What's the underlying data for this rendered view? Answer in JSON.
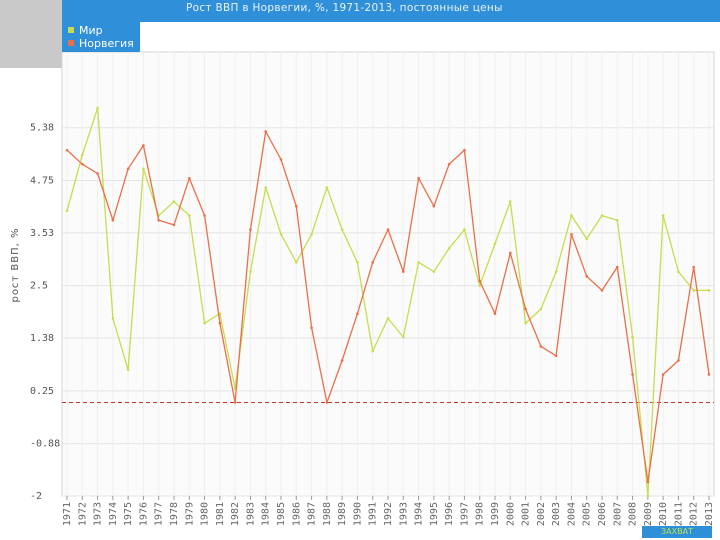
{
  "header": {
    "title": "Рост ВВП в Норвегии, %, 1971-2013, постоянные цены"
  },
  "colors": {
    "world": "#c8dc50",
    "norway": "#e8704a",
    "accent": "#2f8fd8",
    "reference": "#c0392b"
  },
  "chart_data": {
    "type": "line",
    "ylabel": "рост ВВП, %",
    "ylim": [
      -2,
      7.5
    ],
    "yticks": [
      -2,
      -0.88,
      0.25,
      1.38,
      2.5,
      3.63,
      4.75,
      5.88
    ],
    "ytick_labels": [
      "-2",
      "-0.88",
      "0.25",
      "1.38",
      "2.5",
      "3.53",
      "4.75",
      "5.38"
    ],
    "reference_line": 0.0,
    "legend": "top-left",
    "grid": true,
    "categories": [
      "1971",
      "1972",
      "1973",
      "1974",
      "1975",
      "1976",
      "1977",
      "1978",
      "1979",
      "1980",
      "1981",
      "1982",
      "1983",
      "1984",
      "1985",
      "1986",
      "1987",
      "1988",
      "1989",
      "1990",
      "1991",
      "1992",
      "1993",
      "1994",
      "1995",
      "1996",
      "1997",
      "1998",
      "1999",
      "2000",
      "2001",
      "2002",
      "2003",
      "2004",
      "2005",
      "2006",
      "2007",
      "2008",
      "2009",
      "2010",
      "2011",
      "2012",
      "2013"
    ],
    "series": [
      {
        "name": "Мир",
        "values": [
          4.1,
          5.3,
          6.3,
          1.8,
          0.7,
          5.0,
          4.0,
          4.3,
          4.0,
          1.7,
          1.9,
          0.3,
          2.8,
          4.6,
          3.6,
          3.0,
          3.6,
          4.6,
          3.7,
          3.0,
          1.1,
          1.8,
          1.4,
          3.0,
          2.8,
          3.3,
          3.7,
          2.5,
          3.4,
          4.3,
          1.7,
          2.0,
          2.8,
          4.0,
          3.5,
          4.0,
          3.9,
          1.4,
          -2.0,
          4.0,
          2.8,
          2.4,
          2.4
        ]
      },
      {
        "name": "Норвегия",
        "values": [
          5.4,
          5.1,
          4.9,
          3.9,
          5.0,
          5.5,
          3.9,
          3.8,
          4.8,
          4.0,
          1.7,
          0.0,
          3.7,
          5.8,
          5.2,
          4.2,
          1.6,
          0.0,
          0.9,
          1.9,
          3.0,
          3.7,
          2.8,
          4.8,
          4.2,
          5.1,
          5.4,
          2.6,
          1.9,
          3.2,
          2.0,
          1.2,
          1.0,
          3.6,
          2.7,
          2.4,
          2.9,
          0.6,
          -1.7,
          0.6,
          0.9,
          2.9,
          0.6
        ]
      }
    ]
  },
  "badge": {
    "label": "ЗАХВАТ"
  }
}
